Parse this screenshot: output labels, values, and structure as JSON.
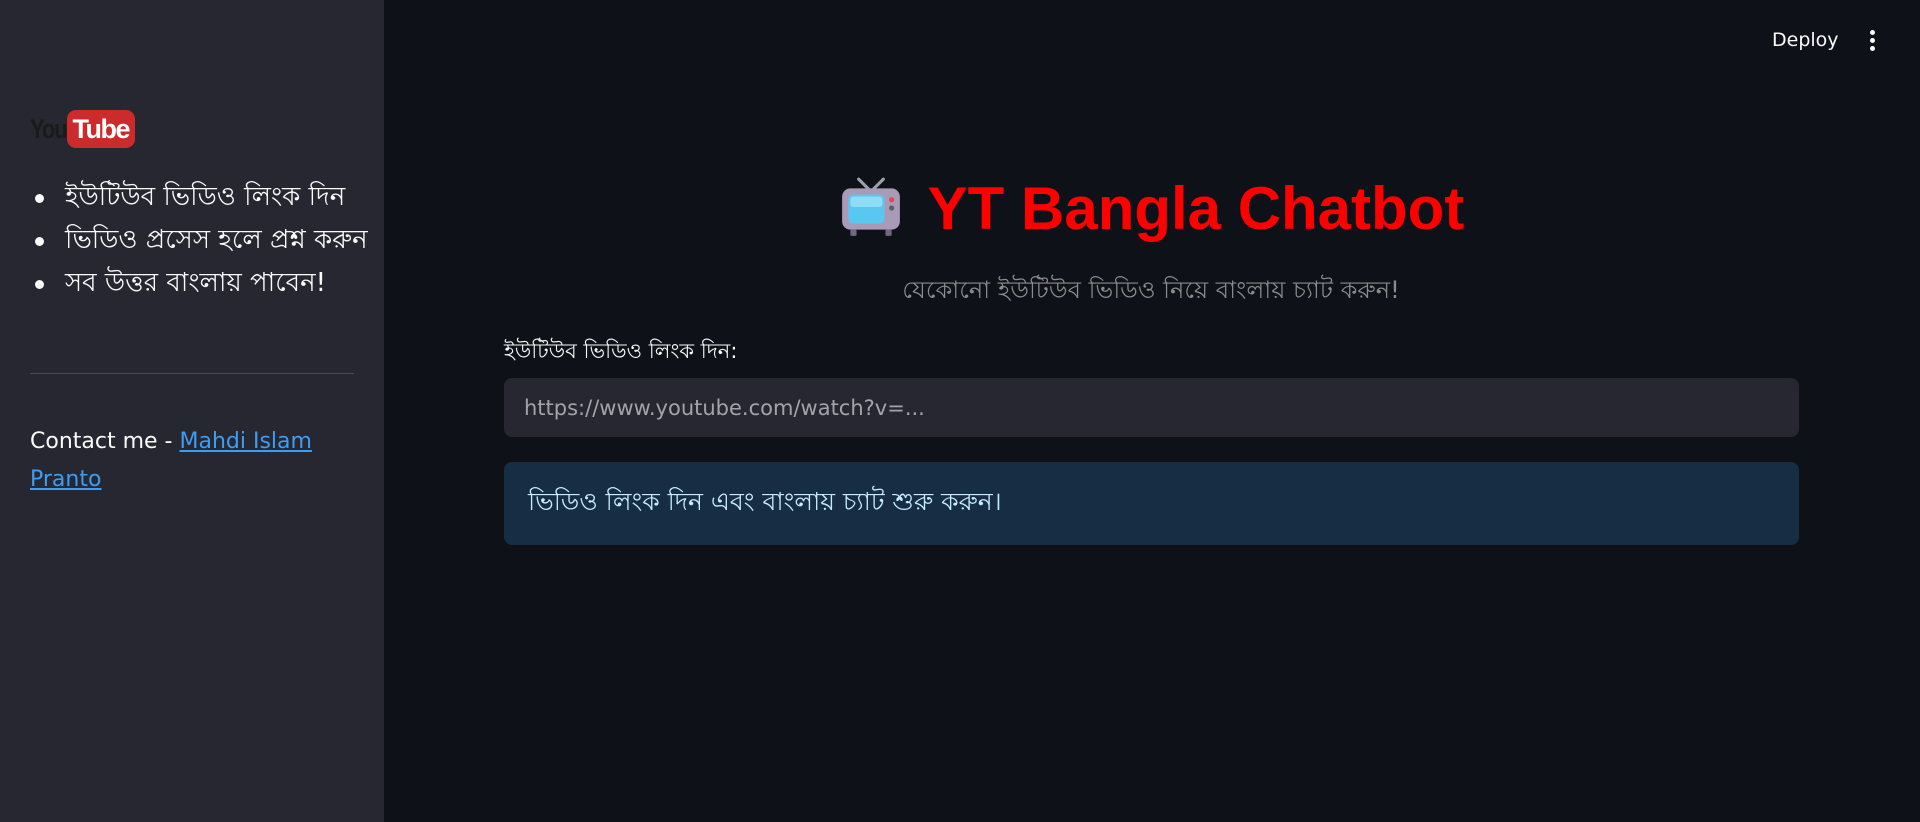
{
  "sidebar": {
    "logo": {
      "you": "You",
      "tube": "Tube"
    },
    "instructions": [
      "ইউটিউব ভিডিও লিংক দিন",
      "ভিডিও প্রসেস হলে প্রশ্ন করুন",
      "সব উত্তর বাংলায় পাবেন!"
    ],
    "contact_prefix": "Contact me - ",
    "contact_name": "Mahdi Islam Pranto"
  },
  "header": {
    "deploy_label": "Deploy",
    "menu_icon": "vertical-ellipsis-icon"
  },
  "main": {
    "title_icon": "television-icon",
    "title": "YT Bangla Chatbot",
    "subtitle": "যেকোনো ইউটিউব ভিডিও নিয়ে বাংলায় চ্যাট করুন!",
    "input_label": "ইউটিউব ভিডিও লিংক দিন:",
    "input_placeholder": "https://www.youtube.com/watch?v=...",
    "input_value": "",
    "info_message": "ভিডিও লিংক দিন এবং বাংলায় চ্যাট শুরু করুন।"
  },
  "colors": {
    "background": "#0e1117",
    "sidebar": "#262730",
    "title": "#ff0000",
    "link": "#3d9df3",
    "info_bg": "#172d43",
    "info_text": "#c7ebff"
  }
}
